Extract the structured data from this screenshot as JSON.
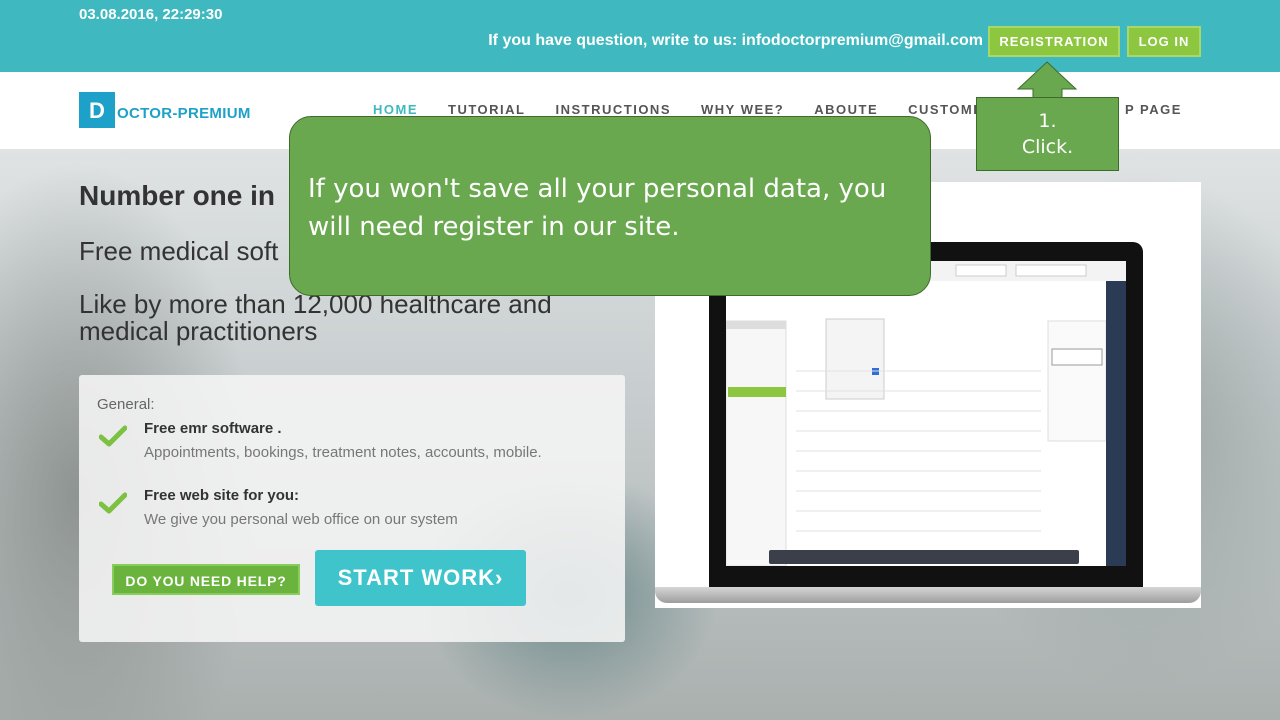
{
  "topbar": {
    "datetime": "03.08.2016, 22:29:30",
    "contact": "If you have question, write to us: infodoctorpremium@gmail.com",
    "registration_label": "REGISTRATION",
    "login_label": "LOG IN"
  },
  "brand": {
    "logo_letter": "D",
    "logo_text": "OCTOR-PREMIUM"
  },
  "nav": {
    "items": [
      "HOME",
      "TUTORIAL",
      "INSTRUCTIONS",
      "WHY WEE?",
      "ABOUTE",
      "CUSTOMERS"
    ],
    "extra": "P PAGE"
  },
  "hero": {
    "title": "Number one in",
    "subtitle": "Free medical soft",
    "like": "Like by more than 12,000 healthcare and medical practitioners"
  },
  "card": {
    "general": "General:",
    "features": [
      {
        "title": "Free emr software .",
        "desc": "Appointments, bookings, treatment notes, accounts, mobile."
      },
      {
        "title": "Free web site for you:",
        "desc": "We give you personal web office on our system"
      }
    ],
    "help_label": "DO YOU NEED HELP?",
    "start_label": "START WORK›"
  },
  "callout": {
    "text": "If you won't save all your personal data, you will need register in our site.",
    "step_number": "1.",
    "step_action": "Click."
  },
  "colors": {
    "topbar": "#3fb9bf",
    "accent_green": "#8dc63f",
    "callout_green": "#6aa84f",
    "start_button": "#3fc4cc"
  }
}
